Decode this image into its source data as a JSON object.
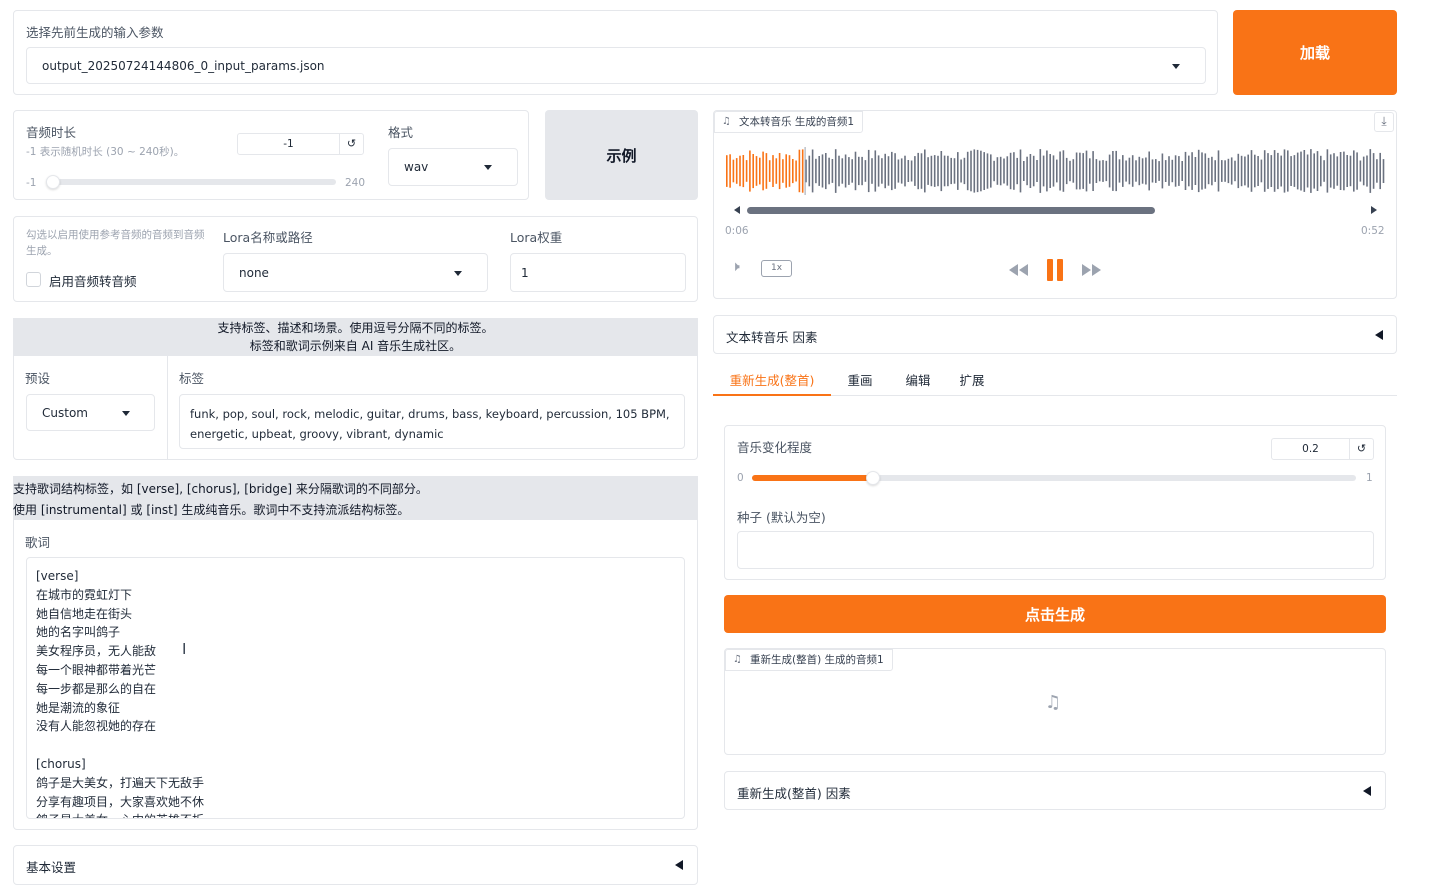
{
  "params": {
    "label": "选择先前生成的输入参数",
    "selected": "output_20250724144806_0_input_params.json",
    "load_button": "加载"
  },
  "duration": {
    "label": "音频时长",
    "hint": "-1 表示随机时长 (30 ~ 240秒)。",
    "value": "-1",
    "reset": "↺",
    "min": "-1",
    "max": "240",
    "fraction": 0.0
  },
  "format": {
    "label": "格式",
    "selected": "wav"
  },
  "example_button": "示例",
  "ref_audio": {
    "hint": "勾选以启用使用参考音频的音频到音频生成。",
    "checkbox_label": "启用音频转音频"
  },
  "lora": {
    "name_label": "Lora名称或路径",
    "name_value": "none",
    "weight_label": "Lora权重",
    "weight_value": "1"
  },
  "tags_banner": {
    "line1": "支持标签、描述和场景。使用逗号分隔不同的标签。",
    "line2": "标签和歌词示例来自 AI 音乐生成社区。"
  },
  "preset": {
    "label": "预设",
    "selected": "Custom"
  },
  "tags": {
    "label": "标签",
    "value": "funk, pop, soul, rock, melodic, guitar, drums, bass, keyboard, percussion, 105 BPM, energetic, upbeat, groovy, vibrant, dynamic"
  },
  "lyrics_banner": {
    "line1": "支持歌词结构标签，如 [verse], [chorus], [bridge] 来分隔歌词的不同部分。",
    "line2": "使用 [instrumental] 或 [inst] 生成纯音乐。歌词中不支持流派结构标签。"
  },
  "lyrics": {
    "label": "歌词",
    "lines": [
      "[verse]",
      "在城市的霓虹灯下",
      "她自信地走在街头",
      "她的名字叫鸽子",
      "美女程序员，无人能敌",
      "每一个眼神都带着光芒",
      "每一步都是那么的自在",
      "她是潮流的象征",
      "没有人能忽视她的存在",
      "",
      "[chorus]",
      "鸽子是大美女，打遍天下无敌手",
      "分享有趣项目，大家喜欢她不休",
      "鸽子是大美女，心中的英雄不折"
    ]
  },
  "basic_settings": "基本设置",
  "player": {
    "tag": "文本转音乐 生成的音频1",
    "current_time": "0:06",
    "total_time": "0:52",
    "speed": "1x",
    "played_fraction": 0.11
  },
  "t2m_factors": "文本转音乐 因素",
  "tabs": [
    {
      "label": "重新生成(整首)",
      "active": true
    },
    {
      "label": "重画",
      "active": false
    },
    {
      "label": "编辑",
      "active": false
    },
    {
      "label": "扩展",
      "active": false
    }
  ],
  "variance": {
    "label": "音乐变化程度",
    "value": "0.2",
    "reset": "↺",
    "min": "0",
    "max": "1",
    "fraction": 0.2
  },
  "seed": {
    "label": "种子 (默认为空)",
    "value": ""
  },
  "generate_button": "点击生成",
  "regen_output": {
    "tag": "重新生成(整首) 生成的音频1"
  },
  "regen_factors": "重新生成(整首) 因素",
  "colors": {
    "accent": "#f97316",
    "band": "#e5e7eb",
    "played": "#f97316",
    "unplayed": "#6b7280"
  }
}
